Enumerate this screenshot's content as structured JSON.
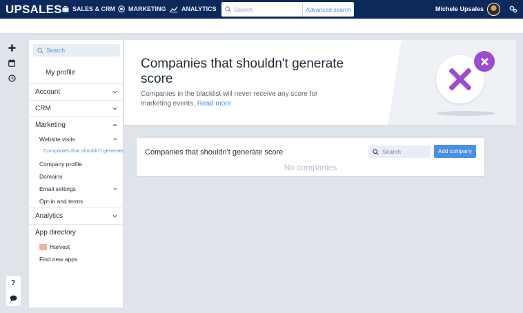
{
  "app": {
    "logo": "UPSALES"
  },
  "topnav": {
    "items": [
      {
        "label": "SALES & CRM",
        "icon": "briefcase-icon"
      },
      {
        "label": "MARKETING",
        "icon": "globe-icon"
      },
      {
        "label": "ANALYTICS",
        "icon": "chart-line-icon"
      }
    ],
    "search_placeholder": "Search",
    "advanced_search": "Advanced search",
    "user_name": "Michele Upsales"
  },
  "rail": {
    "help": "?",
    "icons": [
      "plus-icon",
      "calendar-icon",
      "clock-icon",
      "help-icon",
      "chat-icon"
    ]
  },
  "sidebar": {
    "search_placeholder": "Search",
    "my_profile": "My profile",
    "account": "Account",
    "crm": "CRM",
    "marketing": "Marketing",
    "website_visits": "Website visits",
    "active_item": "Companies that shouldn't generate",
    "company_profile": "Company profile",
    "domains": "Domains",
    "email_settings": "Email settings",
    "opt_in": "Opt-in and terms",
    "analytics": "Analytics",
    "app_directory": "App directory",
    "harvest": "Harvest",
    "find_new_apps": "Find new apps"
  },
  "hero": {
    "title": "Companies that shouldn't generate score",
    "description": "Companies in the blacklist will never receive any score for marketing events.",
    "read_more": "Read more"
  },
  "card": {
    "title": "Companies that shouldn't generate score",
    "search_placeholder": "Search",
    "add_button": "Add company",
    "empty_text": "No companies"
  },
  "colors": {
    "topbar": "#0b2a5b",
    "accent": "#4a90e2",
    "illustration": "#9b4dd2"
  }
}
